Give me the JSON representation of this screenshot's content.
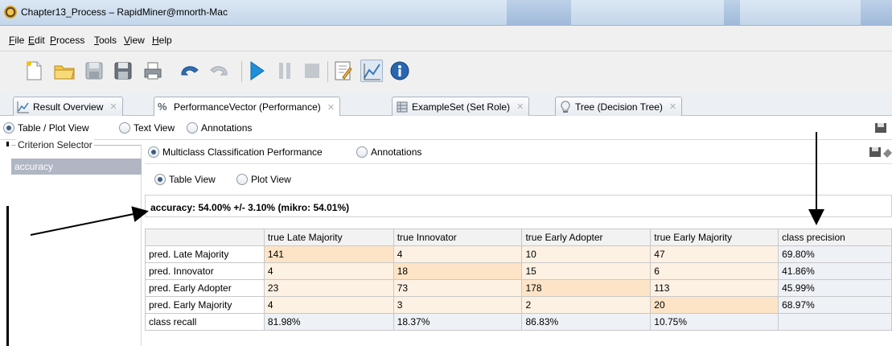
{
  "window": {
    "title": "Chapter13_Process – RapidMiner@mnorth-Mac"
  },
  "menu": [
    {
      "label": "File",
      "u": "F",
      "rest": "ile"
    },
    {
      "label": "Edit",
      "u": "E",
      "rest": "dit"
    },
    {
      "label": "Process",
      "u": "P",
      "rest": "rocess"
    },
    {
      "label": "Tools",
      "u": "T",
      "rest": "ools"
    },
    {
      "label": "View",
      "u": "V",
      "rest": "iew"
    },
    {
      "label": "Help",
      "u": "H",
      "rest": "elp"
    }
  ],
  "toolbar": {
    "icons": [
      "new-process-icon",
      "open-folder-icon",
      "save-icon",
      "save-as-icon",
      "print-icon",
      "undo-icon",
      "redo-icon",
      "run-icon",
      "pause-icon",
      "stop-icon",
      "edit-notes-icon",
      "results-perspective-icon",
      "info-icon"
    ]
  },
  "tabs": [
    {
      "label": "Result Overview",
      "icon": "result-overview-icon"
    },
    {
      "label": "PerformanceVector (Performance)",
      "icon": "percent-icon"
    },
    {
      "label": "ExampleSet (Set Role)",
      "icon": "table-icon"
    },
    {
      "label": "Tree (Decision Tree)",
      "icon": "lightbulb-icon"
    }
  ],
  "view_options": {
    "table_plot": "Table / Plot View",
    "text": "Text View",
    "annotations": "Annotations",
    "selected": "Table / Plot View"
  },
  "criterion": {
    "legend": "Criterion Selector",
    "items": [
      "accuracy"
    ],
    "selected": "accuracy"
  },
  "performance_options": {
    "multiclass": "Multiclass Classification Performance",
    "annotations": "Annotations",
    "selected": "Multiclass Classification Performance"
  },
  "table_view_options": {
    "table": "Table View",
    "plot": "Plot View",
    "selected": "Table View"
  },
  "accuracy_text": "accuracy: 54.00% +/- 3.10% (mikro: 54.01%)",
  "table": {
    "headers": [
      "",
      "true Late Majority",
      "true Innovator",
      "true Early Adopter",
      "true Early Majority",
      "class precision"
    ],
    "rows": [
      [
        "pred. Late Majority",
        "141",
        "4",
        "10",
        "47",
        "69.80%"
      ],
      [
        "pred. Innovator",
        "4",
        "18",
        "15",
        "6",
        "41.86%"
      ],
      [
        "pred. Early Adopter",
        "23",
        "73",
        "178",
        "113",
        "45.99%"
      ],
      [
        "pred. Early Majority",
        "4",
        "3",
        "2",
        "20",
        "68.97%"
      ],
      [
        "class recall",
        "81.98%",
        "18.37%",
        "86.83%",
        "10.75%",
        ""
      ]
    ]
  },
  "colors": {
    "diag": "#fde4c6",
    "offdiag": "#fdf1e3",
    "selected_item": "#b1b6c4"
  }
}
